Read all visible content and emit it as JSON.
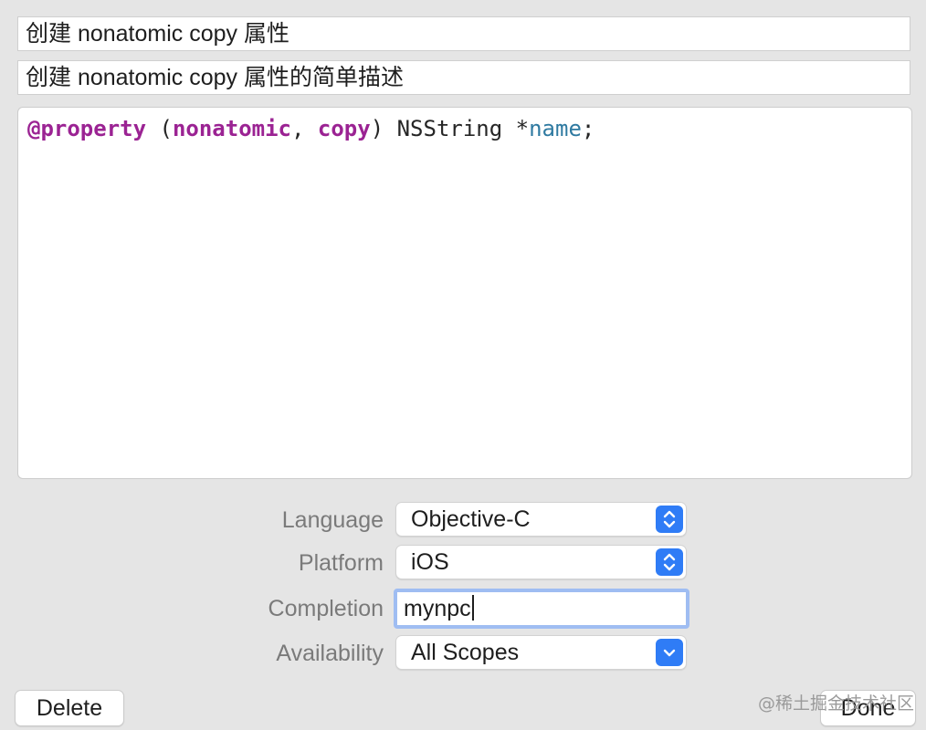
{
  "snippet": {
    "title": "创建 nonatomic copy 属性",
    "summary": "创建 nonatomic copy 属性的简单描述",
    "code_tokens": {
      "at_property": "@property",
      "open_paren": " (",
      "nonatomic": "nonatomic",
      "comma": ", ",
      "copy": "copy",
      "close_type": ") NSString *",
      "name": "name",
      "semicolon": ";"
    }
  },
  "form": {
    "language": {
      "label": "Language",
      "value": "Objective-C"
    },
    "platform": {
      "label": "Platform",
      "value": "iOS"
    },
    "completion": {
      "label": "Completion",
      "value": "mynpc"
    },
    "availability": {
      "label": "Availability",
      "value": "All Scopes"
    }
  },
  "buttons": {
    "delete": "Delete",
    "done": "Done"
  },
  "watermark": "@稀土掘金技术社区",
  "colors": {
    "keyword": "#9b2393",
    "identifier": "#2f7aa1",
    "accent": "#2f7cf6",
    "focus_ring": "#9fbdf2"
  },
  "icons": {
    "language_popup": "up-down-chevron-icon",
    "platform_popup": "up-down-chevron-icon",
    "availability_popup": "chevron-down-icon"
  }
}
